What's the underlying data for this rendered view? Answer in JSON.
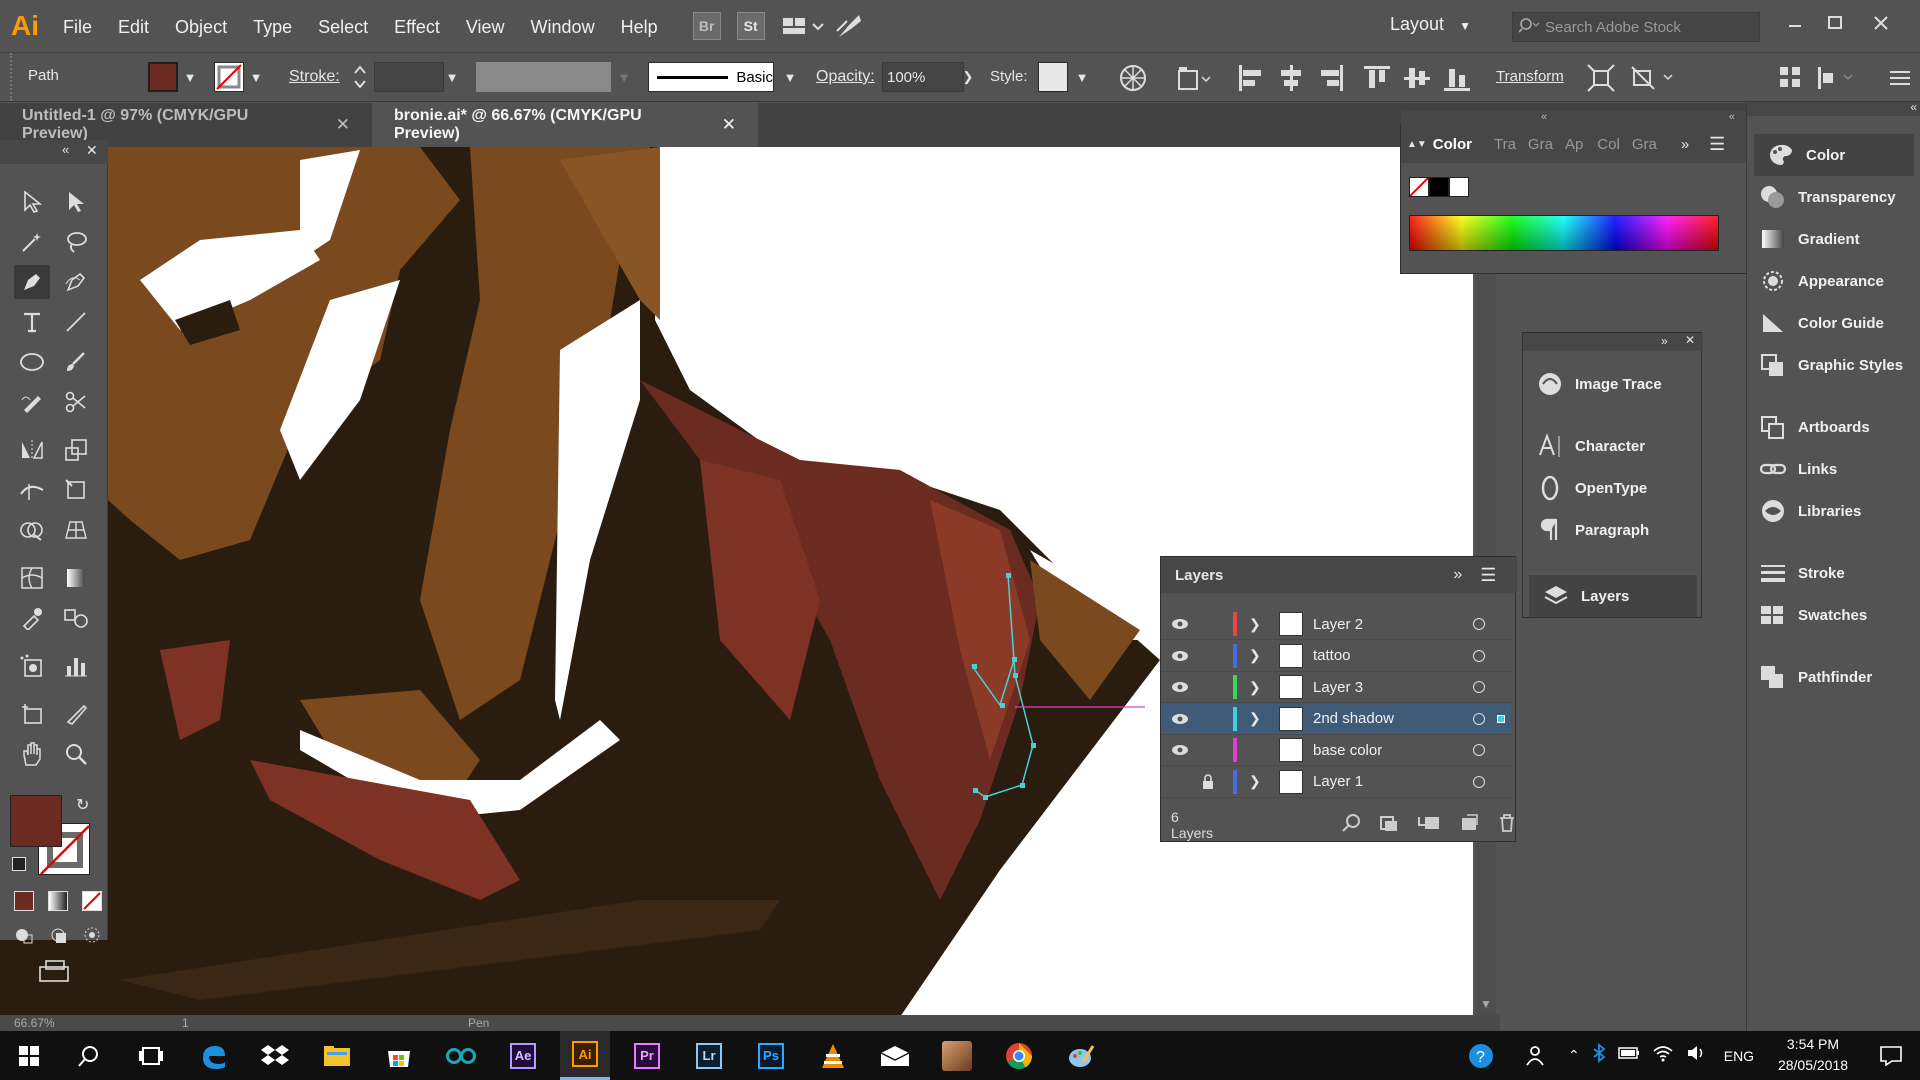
{
  "app": {
    "logo": "Ai"
  },
  "menu": [
    "File",
    "Edit",
    "Object",
    "Type",
    "Select",
    "Effect",
    "View",
    "Window",
    "Help"
  ],
  "app_chips": [
    "Br",
    "St"
  ],
  "workspace": {
    "label": "Layout"
  },
  "search": {
    "placeholder": "Search Adobe Stock"
  },
  "control": {
    "selection_label": "Path",
    "fill_color": "#6b2b20",
    "stroke_label": "Stroke:",
    "brush_label": "Basic",
    "opacity_label": "Opacity:",
    "opacity_value": "100%",
    "style_label": "Style:",
    "transform_label": "Transform"
  },
  "tabs": [
    {
      "label": "Untitled-1 @ 97% (CMYK/GPU Preview)",
      "active": false
    },
    {
      "label": "bronie.ai* @ 66.67% (CMYK/GPU Preview)",
      "active": true
    }
  ],
  "color_panel": {
    "tabs": [
      "Color",
      "Tra",
      "Gra",
      "Ap",
      "Col",
      "Gra"
    ]
  },
  "mid_dock": [
    "Image Trace",
    "Character",
    "OpenType",
    "Paragraph",
    "Layers"
  ],
  "right_dock": [
    "Color",
    "Transparency",
    "Gradient",
    "Appearance",
    "Color Guide",
    "Graphic Styles",
    "Artboards",
    "Links",
    "Libraries",
    "Stroke",
    "Swatches",
    "Pathfinder"
  ],
  "layers_panel": {
    "title": "Layers",
    "count": "6 Layers",
    "layers": [
      {
        "name": "Layer 2",
        "color": "#e84545",
        "visible": true,
        "locked": false,
        "selected": false
      },
      {
        "name": "tattoo",
        "color": "#4a6be0",
        "visible": true,
        "locked": false,
        "selected": false
      },
      {
        "name": "Layer 3",
        "color": "#3ed65a",
        "visible": true,
        "locked": false,
        "selected": false
      },
      {
        "name": "2nd shadow",
        "color": "#3fd0e0",
        "visible": true,
        "locked": false,
        "selected": true
      },
      {
        "name": "base color",
        "color": "#e040d0",
        "visible": true,
        "locked": false,
        "selected": false
      },
      {
        "name": "Layer 1",
        "color": "#4a6be0",
        "visible": false,
        "locked": true,
        "selected": false
      }
    ]
  },
  "status": {
    "zoom": "66.67%",
    "page": "1",
    "tool": "Pen"
  },
  "taskbar": {
    "apps": [
      "Ae",
      "Ai",
      "Pr",
      "Lr",
      "Ps"
    ],
    "lang": "ENG",
    "time": "3:54 PM",
    "date": "28/05/2018"
  }
}
